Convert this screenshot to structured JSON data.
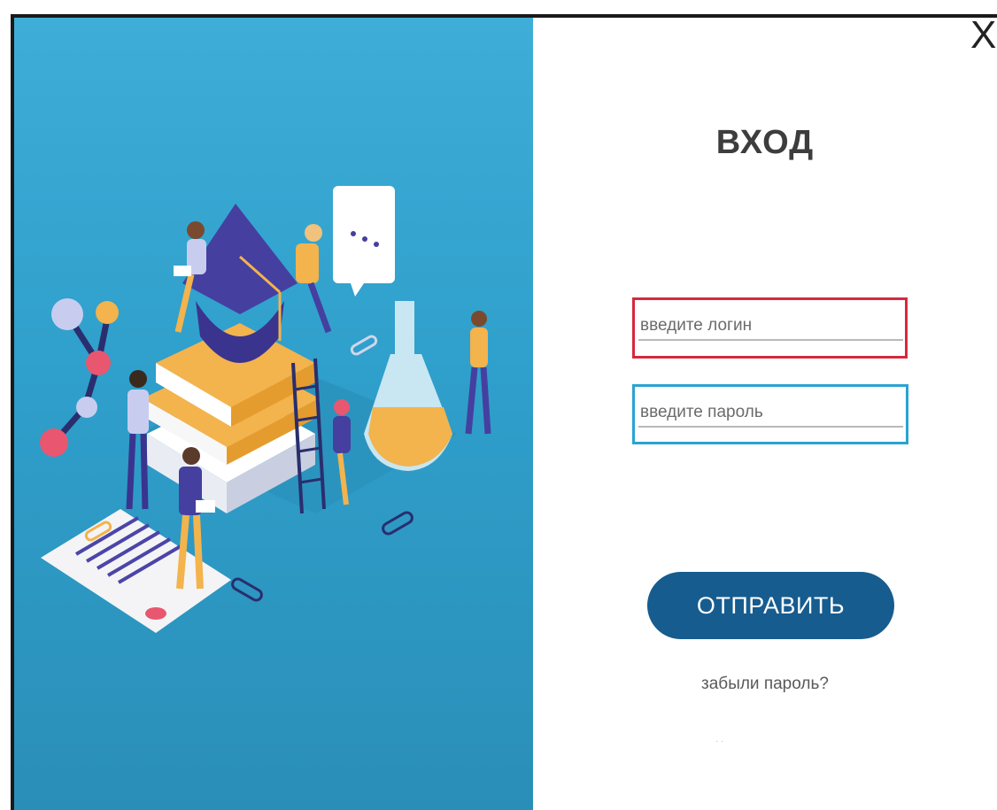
{
  "window": {
    "close_label": "X"
  },
  "login": {
    "title": "ВХОД",
    "login_placeholder": "введите логин",
    "password_placeholder": "введите пароль",
    "submit_label": "ОТПРАВИТЬ",
    "forgot_label": "забыли пароль?"
  },
  "illustration": {
    "icons": [
      "graduation-cap-icon",
      "books-stack-icon",
      "flask-icon",
      "molecule-icon",
      "speech-bubble-icon",
      "document-icon",
      "paperclip-icon",
      "ladder-icon"
    ]
  },
  "colors": {
    "panel_blue": "#3eaed8",
    "login_border": "#d5293f",
    "password_border": "#2aa3d3",
    "button": "#165c8f"
  }
}
